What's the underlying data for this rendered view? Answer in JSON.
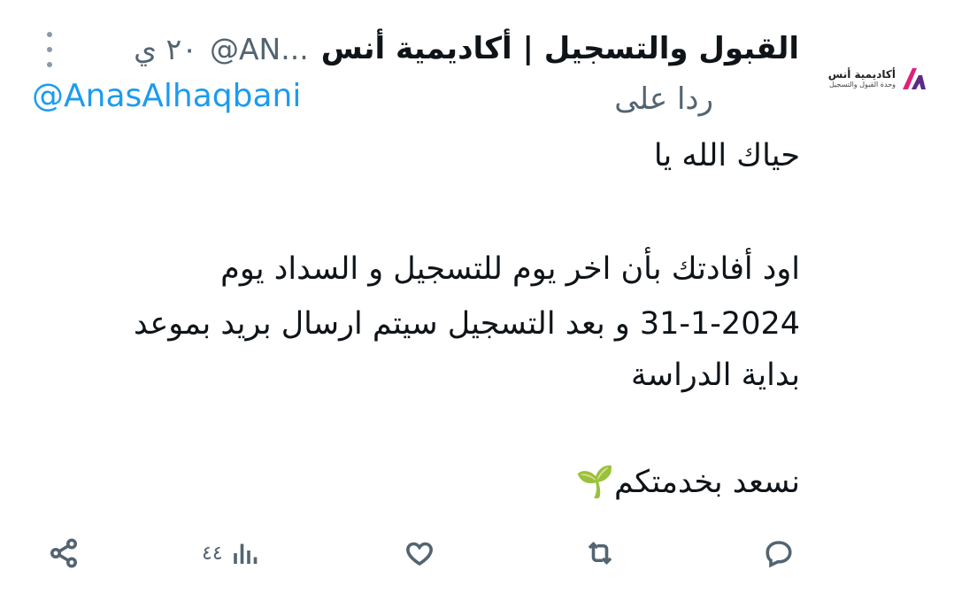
{
  "tweet": {
    "display_name": "القبول والتسجيل | أكاديمية أنس",
    "handle": "@AN...",
    "time": "٢٠ ي",
    "reply_label": "ردا على",
    "reply_handle": "@AnasAlhaqbani",
    "lines": [
      "حياك الله يا",
      "اود أفادتك بأن اخر يوم للتسجيل و السداد يوم",
      "31-1-2024 و بعد التسجيل سيتم ارسال بريد بموعد",
      "بداية الدراسة",
      "نسعد بخدمتكم🌱"
    ],
    "views_count": "٤٤"
  },
  "avatar": {
    "title": "أكاديمية أنس",
    "subtitle": "وحدة القبول والتسجيل",
    "brand_colors": [
      "#e0207a",
      "#5b2a86"
    ]
  },
  "icons": {
    "more": "more-vertical-icon",
    "reply": "reply-icon",
    "retweet": "retweet-icon",
    "like": "heart-icon",
    "views": "views-bar-chart-icon",
    "share": "share-icon"
  },
  "colors": {
    "link": "#1d9bf0",
    "muted": "#536471",
    "text": "#0f1419"
  }
}
